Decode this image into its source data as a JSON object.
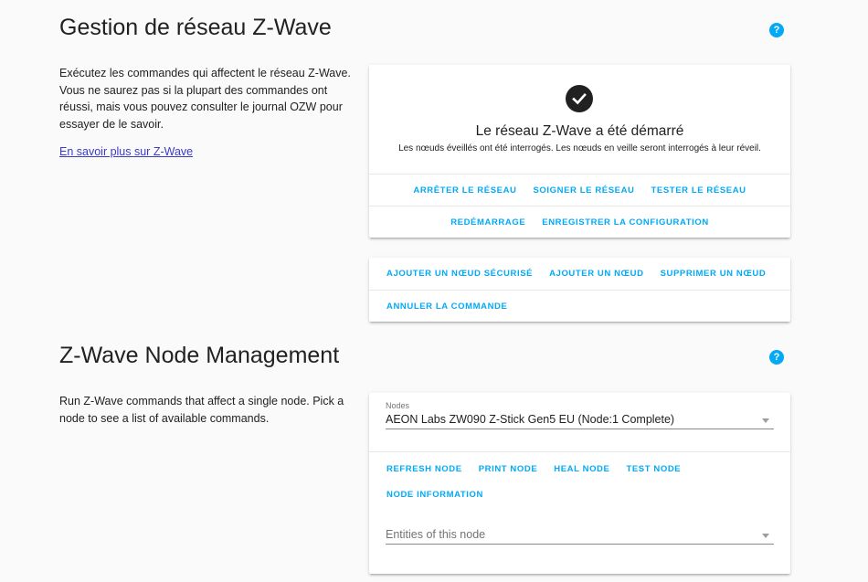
{
  "network": {
    "title": "Gestion de réseau Z-Wave",
    "help_icon": "question-mark",
    "intro": "Exécutez les commandes qui affectent le réseau Z-Wave. Vous ne saurez pas si la plupart des commandes ont réussi, mais vous pouvez consulter le journal OZW pour essayer de le savoir.",
    "learn_more": "En savoir plus sur Z-Wave",
    "status_icon": "check-circle",
    "status_title": "Le réseau Z-Wave a été démarré",
    "status_subtitle": "Les nœuds éveillés ont été interrogés. Les nœuds en veille seront interrogés à leur réveil.",
    "row1": [
      "ARRÊTER LE RÉSEAU",
      "SOIGNER LE RÉSEAU",
      "TESTER LE RÉSEAU"
    ],
    "row2": [
      "REDÉMARRAGE",
      "ENREGISTRER LA CONFIGURATION"
    ],
    "node_row1": [
      "AJOUTER UN NŒUD SÉCURISÉ",
      "AJOUTER UN NŒUD",
      "SUPPRIMER UN NŒUD"
    ],
    "node_row2": [
      "ANNULER LA COMMANDE"
    ]
  },
  "node_mgmt": {
    "title": "Z-Wave Node Management",
    "help_icon": "question-mark",
    "intro": "Run Z-Wave commands that affect a single node. Pick a node to see a list of available commands.",
    "nodes_label": "Nodes",
    "nodes_value": "AEON Labs ZW090 Z-Stick Gen5 EU (Node:1 Complete)",
    "row1": [
      "REFRESH NODE",
      "PRINT NODE",
      "HEAL NODE",
      "TEST NODE"
    ],
    "row2": [
      "NODE INFORMATION"
    ],
    "entities_placeholder": "Entities of this node"
  },
  "colors": {
    "accent": "#03a9f4",
    "text": "#212121",
    "link": "#3b3bc9",
    "background": "#fafafa"
  }
}
